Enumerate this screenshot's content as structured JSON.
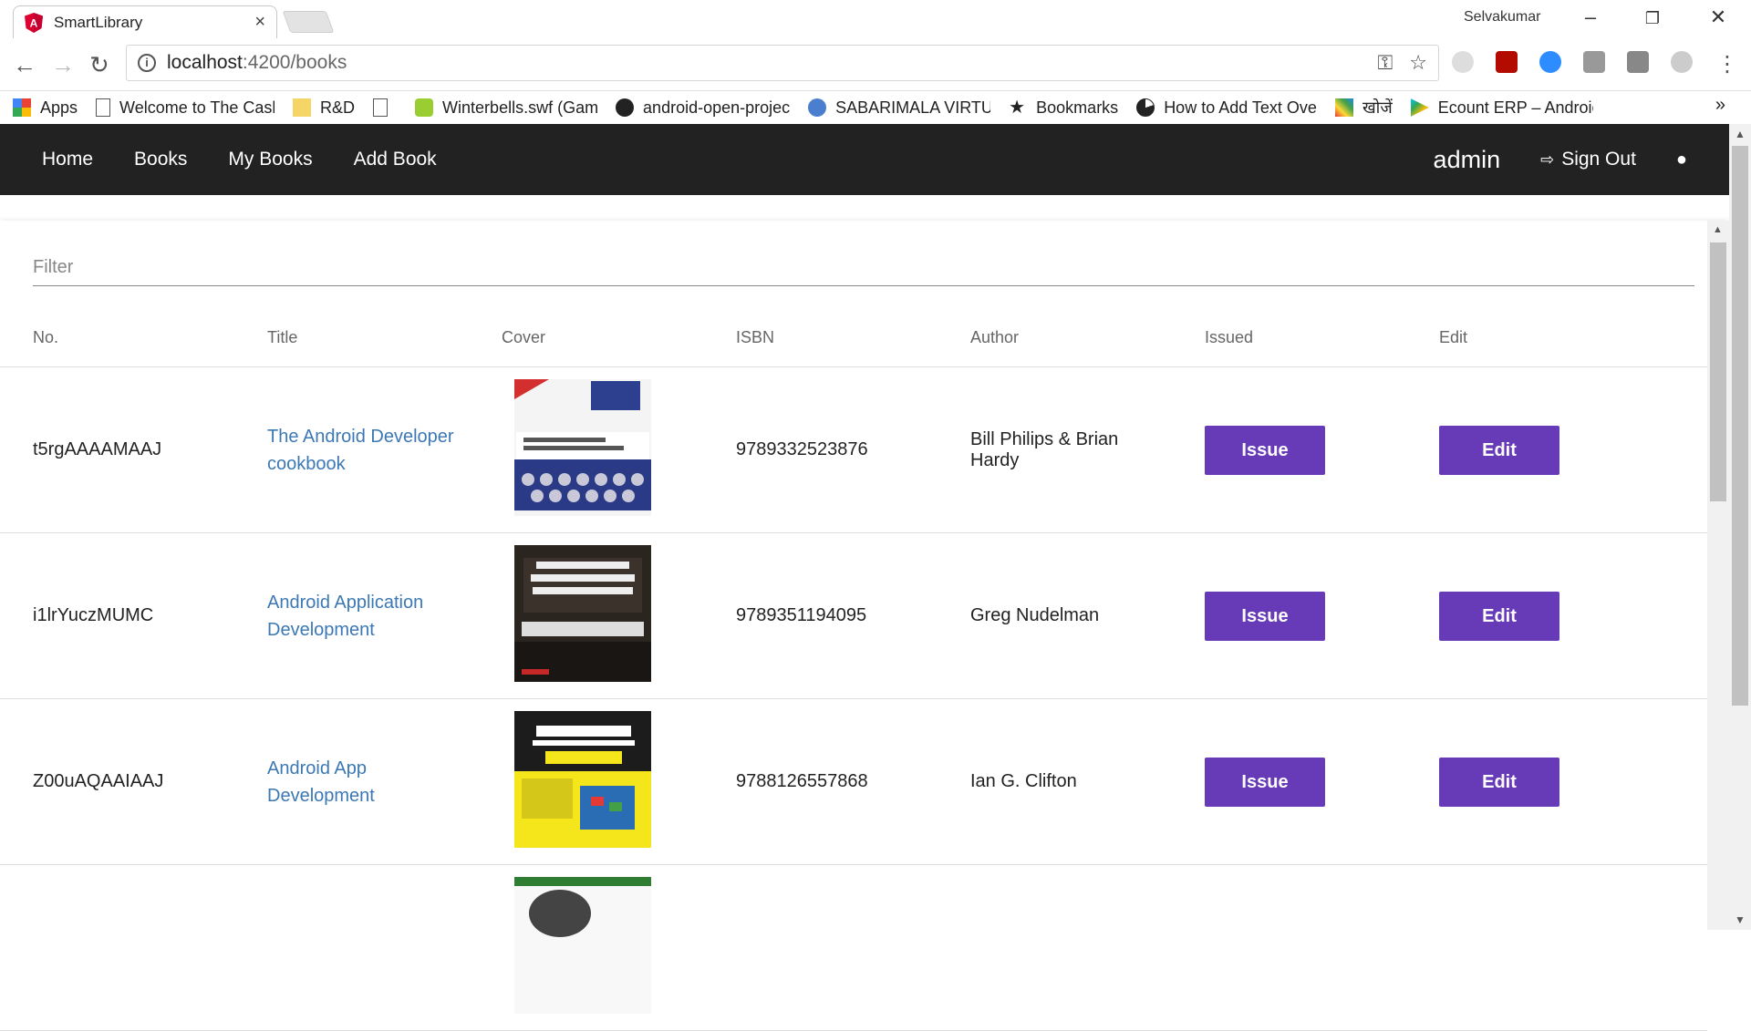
{
  "browser": {
    "tab_title": "SmartLibrary",
    "tab_close": "×",
    "profile_name": "Selvakumar",
    "url_host": "localhost",
    "url_path": ":4200/books",
    "bookmarks": [
      {
        "label": "Apps",
        "icon": "apps-grid-icon"
      },
      {
        "label": "Welcome to The Cash",
        "icon": "page-icon"
      },
      {
        "label": "R&D",
        "icon": "folder-icon"
      },
      {
        "label": "",
        "icon": "page-icon"
      },
      {
        "label": "Winterbells.swf (Gam",
        "icon": "green-app-icon"
      },
      {
        "label": "android-open-projec",
        "icon": "github-icon"
      },
      {
        "label": "SABARIMALA VIRTUA",
        "icon": "globe-icon"
      },
      {
        "label": "Bookmarks",
        "icon": "star-icon"
      },
      {
        "label": "How to Add Text Ove",
        "icon": "pie-icon"
      },
      {
        "label": "खोजें",
        "icon": "colorful-icon"
      },
      {
        "label": "Ecount ERP – Androic",
        "icon": "play-icon"
      }
    ],
    "bookmarks_more": "»"
  },
  "nav": {
    "home": "Home",
    "books": "Books",
    "my_books": "My Books",
    "add_book": "Add Book",
    "user": "admin",
    "sign_out": "Sign Out"
  },
  "filter": {
    "placeholder": "Filter"
  },
  "table": {
    "headers": [
      "No.",
      "Title",
      "Cover",
      "ISBN",
      "Author",
      "Issued",
      "Edit"
    ],
    "rows": [
      {
        "no": "t5rgAAAAMAAJ",
        "title": "The Android Developer cookbook",
        "isbn": "9789332523876",
        "author": "Bill Philips & Brian Hardy",
        "issue": "Issue",
        "edit": "Edit"
      },
      {
        "no": "i1lrYuczMUMC",
        "title": "Android Application Development",
        "isbn": "9789351194095",
        "author": "Greg Nudelman",
        "issue": "Issue",
        "edit": "Edit"
      },
      {
        "no": "Z00uAQAAIAAJ",
        "title": "Android App Development",
        "isbn": "9788126557868",
        "author": "Ian G. Clifton",
        "issue": "Issue",
        "edit": "Edit"
      }
    ]
  },
  "colors": {
    "nav_bg": "#222222",
    "button": "#673ab7",
    "link": "#3c78b4"
  }
}
